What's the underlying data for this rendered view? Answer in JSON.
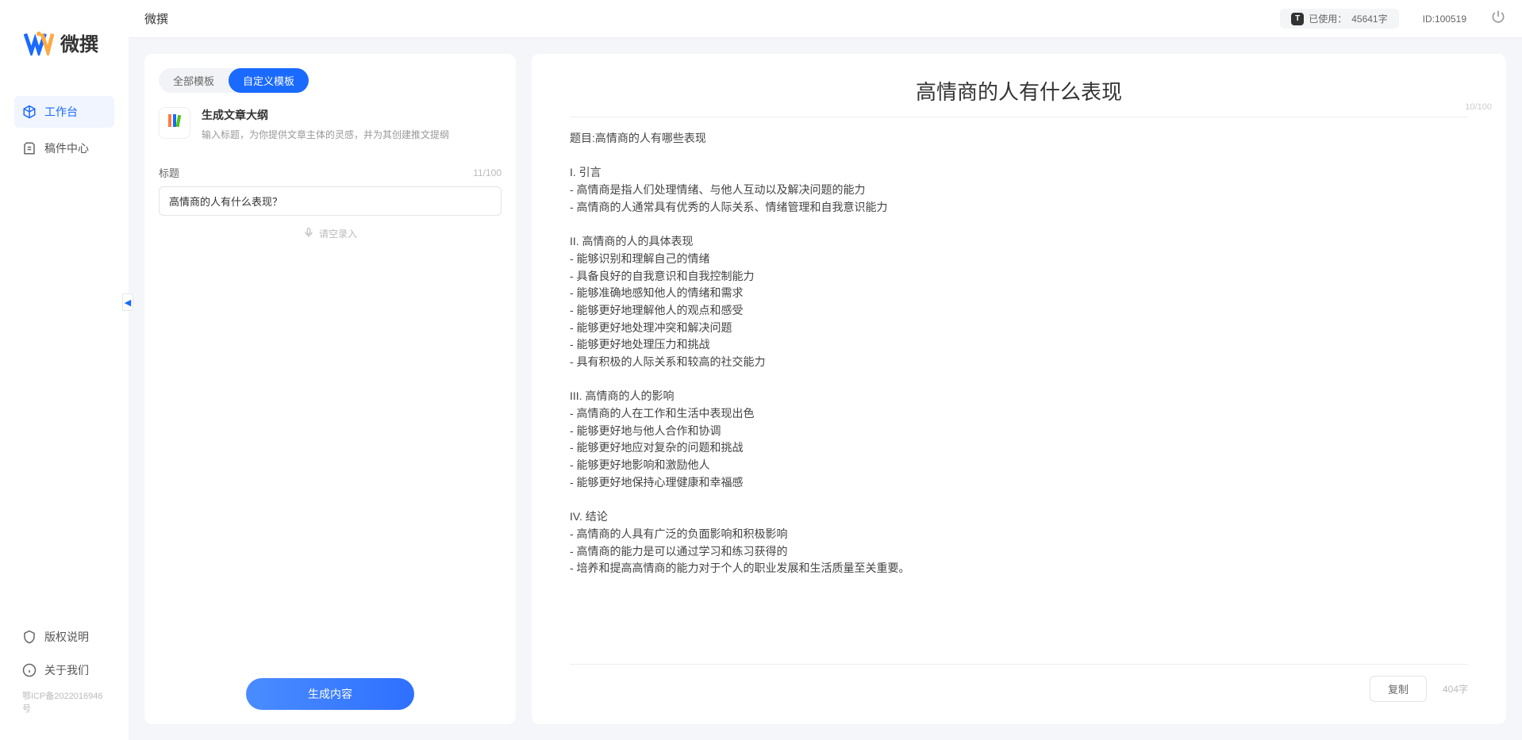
{
  "app": {
    "brand": "微撰",
    "title": "微撰"
  },
  "topbar": {
    "usage_icon_letter": "T",
    "usage_label": "已使用：",
    "usage_value": "45641字",
    "user_id_label": "ID:100519"
  },
  "sidebar": {
    "nav": [
      {
        "label": "工作台",
        "active": true
      },
      {
        "label": "稿件中心",
        "active": false
      }
    ],
    "footer": [
      {
        "label": "版权说明"
      },
      {
        "label": "关于我们"
      }
    ],
    "icp": "鄂ICP备2022016946号"
  },
  "leftPanel": {
    "tabs": [
      {
        "label": "全部模板",
        "active": false
      },
      {
        "label": "自定义模板",
        "active": true
      }
    ],
    "template": {
      "name": "生成文章大纲",
      "desc": "输入标题，为你提供文章主体的灵感，并为其创建推文提纲"
    },
    "field": {
      "label": "标题",
      "counter": "11/100",
      "value": "高情商的人有什么表现？"
    },
    "voice_hint": "请空录入",
    "generate": "生成内容"
  },
  "output": {
    "title": "高情商的人有什么表现",
    "header_counter": "10/100",
    "body": "题目:高情商的人有哪些表现\n\nI. 引言\n- 高情商是指人们处理情绪、与他人互动以及解决问题的能力\n- 高情商的人通常具有优秀的人际关系、情绪管理和自我意识能力\n\nII. 高情商的人的具体表现\n- 能够识别和理解自己的情绪\n- 具备良好的自我意识和自我控制能力\n- 能够准确地感知他人的情绪和需求\n- 能够更好地理解他人的观点和感受\n- 能够更好地处理冲突和解决问题\n- 能够更好地处理压力和挑战\n- 具有积极的人际关系和较高的社交能力\n\nIII. 高情商的人的影响\n- 高情商的人在工作和生活中表现出色\n- 能够更好地与他人合作和协调\n- 能够更好地应对复杂的问题和挑战\n- 能够更好地影响和激励他人\n- 能够更好地保持心理健康和幸福感\n\nIV. 结论\n- 高情商的人具有广泛的负面影响和积极影响\n- 高情商的能力是可以通过学习和练习获得的\n- 培养和提高高情商的能力对于个人的职业发展和生活质量至关重要。",
    "copy_label": "复制",
    "word_count": "404字"
  }
}
